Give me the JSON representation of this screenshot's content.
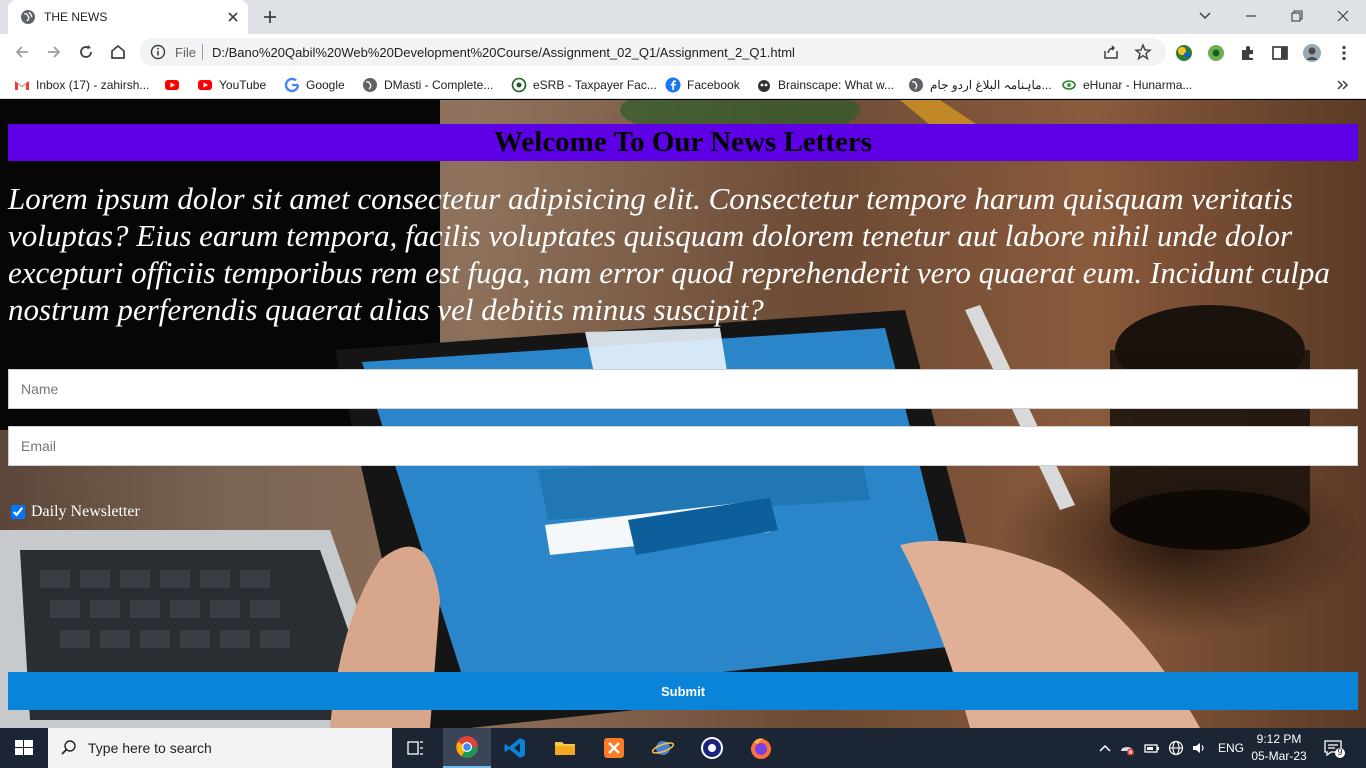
{
  "browser": {
    "tab_title": "THE NEWS",
    "scheme_label": "File",
    "url": "D:/Bano%20Qabil%20Web%20Development%20Course/Assignment_02_Q1/Assignment_2_Q1.html",
    "bookmarks": [
      {
        "label": "Inbox (17) - zahirsh...",
        "icon": "gmail-icon"
      },
      {
        "label": "",
        "icon": "youtube-icon"
      },
      {
        "label": "YouTube",
        "icon": "youtube-icon"
      },
      {
        "label": "Google",
        "icon": "google-icon"
      },
      {
        "label": "DMasti - Complete...",
        "icon": "globe-icon"
      },
      {
        "label": "eSRB - Taxpayer Fac...",
        "icon": "seal-icon"
      },
      {
        "label": "Facebook",
        "icon": "facebook-icon"
      },
      {
        "label": "Brainscape: What w...",
        "icon": "brainscape-icon"
      },
      {
        "label": "ماہنامہ البلاغ اردو جام...",
        "icon": "globe-icon"
      },
      {
        "label": "eHunar - Hunarma...",
        "icon": "ehunar-icon"
      }
    ]
  },
  "page": {
    "heading": "Welcome To Our News Letters",
    "lead": "Lorem ipsum dolor sit amet consectetur adipisicing elit. Consectetur tempore harum quisquam veritatis voluptas? Eius earum tempora, facilis voluptates quisquam dolorem tenetur aut labore nihil unde dolor excepturi officiis temporibus rem est fuga, nam error quod reprehenderit vero quaerat eum. Incidunt culpa nostrum perferendis quaerat alias vel debitis minus suscipit?",
    "name_placeholder": "Name",
    "email_placeholder": "Email",
    "newsletter_label": "Daily Newsletter",
    "newsletter_checked": true,
    "submit_label": "Submit",
    "accent_color": "#5d00e6",
    "button_color": "#0a84d9"
  },
  "taskbar": {
    "search_placeholder": "Type here to search",
    "language": "ENG",
    "time": "9:12 PM",
    "date": "05-Mar-23",
    "notification_count": "9"
  }
}
